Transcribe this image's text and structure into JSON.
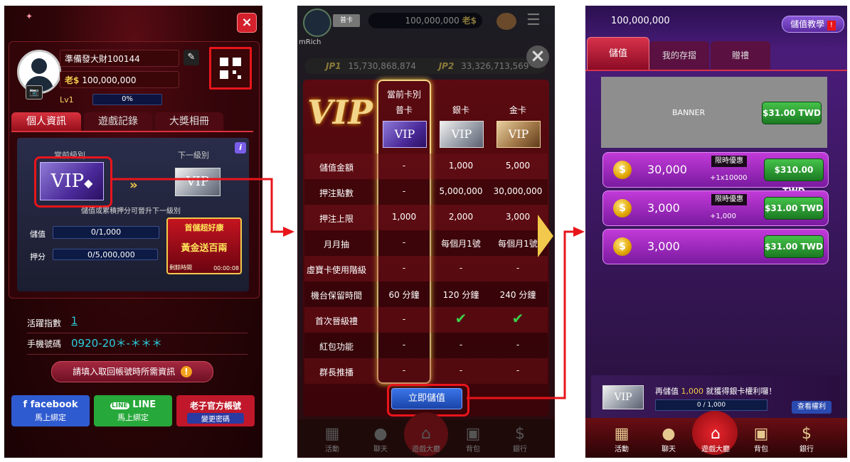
{
  "panel1": {
    "close_icon": "×",
    "username": "準備發大財100144",
    "coin_symbol": "老$",
    "balance": "100,000,000",
    "level": "Lv1",
    "progress_text": "0%",
    "progress_fraction": 0,
    "tabs": [
      "個人資訊",
      "遊戲記錄",
      "大獎相冊"
    ],
    "current_level_label": "當前級別",
    "next_level_label": "下一級別",
    "vip_text": "VIP",
    "upgrade_hint": "儲值或累積押分可晉升下一級別",
    "deposit_label": "儲值",
    "deposit_value": "0/1,000",
    "bet_label": "押分",
    "bet_value": "0/5,000,000",
    "promo_title": "首儲超好康",
    "promo_sub": "黃金送百兩",
    "promo_timer_label": "剩餘時間",
    "promo_timer": "00:00:08",
    "activity_label": "活躍指數",
    "activity_value": "1",
    "phone_label": "手機號碼",
    "phone_value": "0920-20＊-＊＊＊",
    "recover_button": "請填入取回帳號時所需資訊",
    "facebook_title": "facebook",
    "facebook_sub": "馬上綁定",
    "line_title": "LINE",
    "line_sub": "馬上綁定",
    "official_title": "老子官方帳號",
    "official_sub": "變更密碼"
  },
  "panel2": {
    "header_balance": "100,000,000",
    "header_coin": "老$",
    "header_name": "mRich",
    "jp1_label": "JP1",
    "jp1_value": "15,730,868,874",
    "jp2_label": "JP2",
    "jp2_value": "33,326,713,569",
    "current_card_label": "當前卡別",
    "cards": [
      "普卡",
      "銀卡",
      "金卡"
    ],
    "vip_text": "VIP",
    "rows": [
      {
        "label": "儲值金額",
        "values": [
          "-",
          "1,000",
          "5,000"
        ]
      },
      {
        "label": "押注點數",
        "values": [
          "-",
          "5,000,000",
          "30,000,000"
        ]
      },
      {
        "label": "押注上限",
        "values": [
          "1,000",
          "2,000",
          "3,000"
        ]
      },
      {
        "label": "月月抽",
        "values": [
          "-",
          "每個月1號",
          "每個月1號"
        ]
      },
      {
        "label": "虛寶卡使用階級",
        "values": [
          "-",
          "-",
          "-"
        ]
      },
      {
        "label": "機台保留時間",
        "values": [
          "60 分鐘",
          "120 分鐘",
          "240 分鐘"
        ]
      },
      {
        "label": "首次晉級禮",
        "values": [
          "-",
          "✔",
          "✔"
        ]
      },
      {
        "label": "紅包功能",
        "values": [
          "-",
          "-",
          "-"
        ]
      },
      {
        "label": "群長推播",
        "values": [
          "-",
          "-",
          "-"
        ]
      }
    ],
    "deposit_now": "立即儲值",
    "nav": [
      "活動",
      "聊天",
      "遊戲大廳",
      "背包",
      "銀行"
    ]
  },
  "panel3": {
    "balance": "100,000,000",
    "tutorial_button": "儲值教學",
    "tabs": [
      "儲值",
      "我的存摺",
      "贈禮"
    ],
    "banner_text": "BANNER",
    "banner_price": "$31.00 TWD",
    "items": [
      {
        "amount": "30,000",
        "badge": "限時優惠",
        "bonus": "+1x10000",
        "price": "$310.00 TWD"
      },
      {
        "amount": "3,000",
        "badge": "限時優惠",
        "bonus": "+1,000",
        "price": "$31.00 TWD"
      },
      {
        "amount": "3,000",
        "badge": "",
        "bonus": "",
        "price": "$31.00 TWD"
      }
    ],
    "promo_text_pre": "再儲值",
    "promo_amount": "1,000",
    "promo_text_post": "就獲得銀卡權利囉！",
    "promo_progress": "0 / 1,000",
    "view_rights": "查看權利",
    "nav": [
      "活動",
      "聊天",
      "遊戲大廳",
      "背包",
      "銀行"
    ]
  },
  "colors": {
    "highlight_red": "#e8151b",
    "accent_gold": "#f2c94c",
    "price_green": "#2e9e34"
  }
}
